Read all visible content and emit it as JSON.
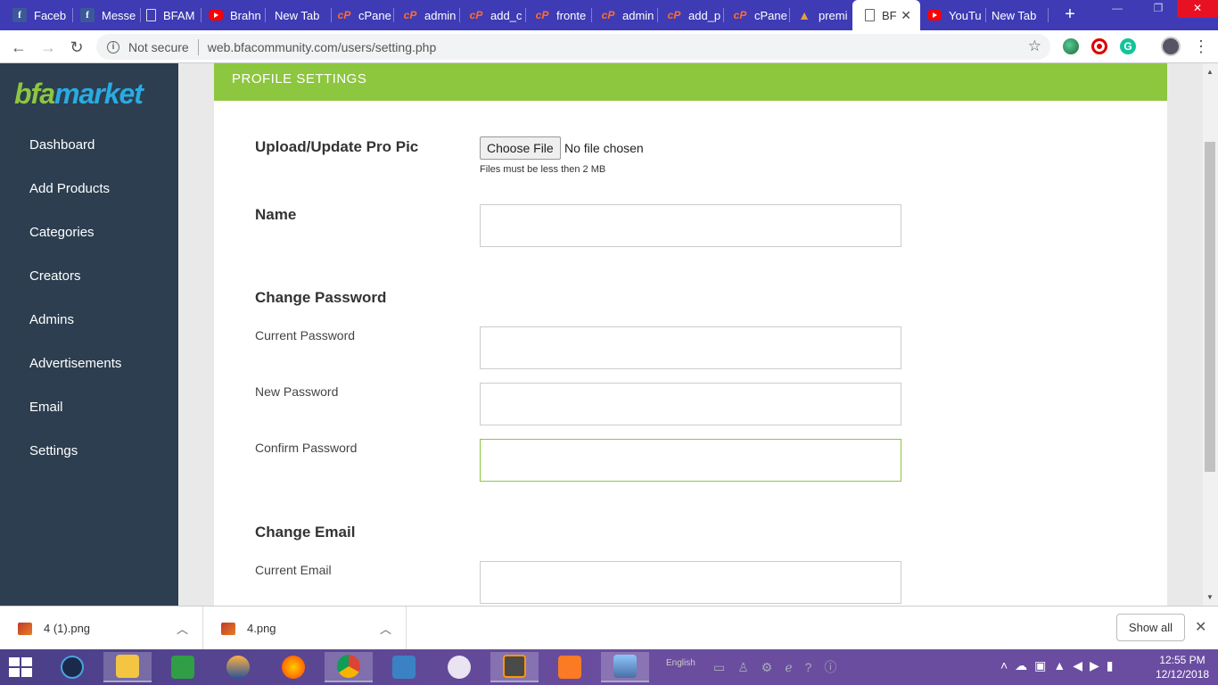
{
  "browser": {
    "tabs": [
      {
        "label": "Faceb",
        "favicon": "facebook-icon"
      },
      {
        "label": "Messe",
        "favicon": "facebook-icon"
      },
      {
        "label": "BFAM",
        "favicon": "page-icon"
      },
      {
        "label": "Brahn",
        "favicon": "youtube-icon"
      },
      {
        "label": "New Tab",
        "favicon": ""
      },
      {
        "label": "cPane",
        "favicon": "cpanel-icon"
      },
      {
        "label": "admin",
        "favicon": "cpanel-icon"
      },
      {
        "label": "add_c",
        "favicon": "cpanel-icon"
      },
      {
        "label": "fronte",
        "favicon": "cpanel-icon"
      },
      {
        "label": "admin",
        "favicon": "cpanel-icon"
      },
      {
        "label": "add_p",
        "favicon": "cpanel-icon"
      },
      {
        "label": "cPane",
        "favicon": "cpanel-icon"
      },
      {
        "label": "premi",
        "favicon": "premier-icon"
      },
      {
        "label": "BF",
        "favicon": "page-icon",
        "active": true
      },
      {
        "label": "YouTu",
        "favicon": "youtube-icon"
      },
      {
        "label": "New Tab",
        "favicon": ""
      }
    ],
    "security_label": "Not secure",
    "url": "web.bfacommunity.com/users/setting.php",
    "accent_color": "#3e3bb5"
  },
  "sidebar": {
    "logo_part1": "bfa",
    "logo_part2": "market",
    "bg_color": "#2c3e50",
    "items": [
      {
        "label": "Dashboard"
      },
      {
        "label": "Add Products"
      },
      {
        "label": "Categories"
      },
      {
        "label": "Creators"
      },
      {
        "label": "Admins"
      },
      {
        "label": "Advertisements"
      },
      {
        "label": "Email"
      },
      {
        "label": "Settings"
      }
    ]
  },
  "main": {
    "header_title": "PROFILE SETTINGS",
    "header_color": "#8dc63f",
    "pro_pic": {
      "label": "Upload/Update Pro Pic",
      "button_label": "Choose File",
      "status": "No file chosen",
      "hint": "Files must be less then 2 MB"
    },
    "name": {
      "label": "Name",
      "value": ""
    },
    "password_section": {
      "title": "Change Password",
      "current_label": "Current Password",
      "current_value": "",
      "new_label": "New Password",
      "new_value": "",
      "confirm_label": "Confirm Password",
      "confirm_value": ""
    },
    "email_section": {
      "title": "Change Email",
      "current_label": "Current Email",
      "current_value": ""
    }
  },
  "downloads": {
    "items": [
      {
        "name": "4 (1).png"
      },
      {
        "name": "4.png"
      }
    ],
    "show_all_label": "Show all"
  },
  "taskbar": {
    "language": "English",
    "time": "12:55 PM",
    "date": "12/12/2018"
  }
}
